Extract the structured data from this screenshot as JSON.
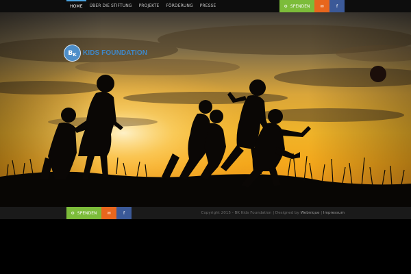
{
  "nav": {
    "items": [
      {
        "label": "HOME",
        "active": true
      },
      {
        "label": "ÜBER DIE STIFTUNG",
        "active": false
      },
      {
        "label": "PROJEKTE",
        "active": false
      },
      {
        "label": "FÖRDERUNG",
        "active": false
      },
      {
        "label": "PRESSE",
        "active": false
      }
    ]
  },
  "header_buttons": {
    "spenden_label": "SPENDEN",
    "mail_icon": "envelope-icon",
    "facebook_icon": "facebook-icon",
    "facebook_glyph": "f"
  },
  "logo": {
    "initials_b": "B",
    "initials_k": "K",
    "name": "KIDS FOUNDATION"
  },
  "footer": {
    "spenden_label": "SPENDEN",
    "facebook_glyph": "f",
    "copyright": "Copyright 2015 - BK Kids Foundation | Designed by",
    "designer": "Webnique",
    "separator": "|",
    "impressum": "Impressum"
  },
  "colors": {
    "accent_blue": "#4aa3df",
    "spenden_green": "#7cbc3a",
    "mail_orange": "#e8661d",
    "facebook_blue": "#3b5998",
    "logo_blue": "#3f88c8"
  }
}
